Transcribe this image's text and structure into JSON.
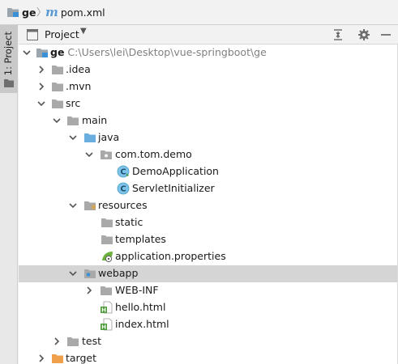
{
  "breadcrumb": {
    "project": "ge",
    "file": "pom.xml"
  },
  "stripe": {
    "tab_label": "1: Project"
  },
  "panel": {
    "title": "Project"
  },
  "tree": {
    "root_name": "ge",
    "root_path": "C:\\Users\\lei\\Desktop\\vue-springboot\\ge",
    "idea": ".idea",
    "mvn": ".mvn",
    "src": "src",
    "main": "main",
    "java": "java",
    "package": "com.tom.demo",
    "demo_app": "DemoApplication",
    "servlet_init": "ServletInitializer",
    "resources": "resources",
    "static": "static",
    "templates": "templates",
    "app_props": "application.properties",
    "webapp": "webapp",
    "web_inf": "WEB-INF",
    "hello": "hello.html",
    "index": "index.html",
    "test": "test",
    "target": "target"
  },
  "colors": {
    "folder": "#a9a9a9",
    "source_folder": "#6aaee0",
    "resources_accent": "#e2a23b",
    "class_icon": "#7dc3e8",
    "target_folder": "#f0a04a",
    "selection": "#d5d5d5"
  }
}
